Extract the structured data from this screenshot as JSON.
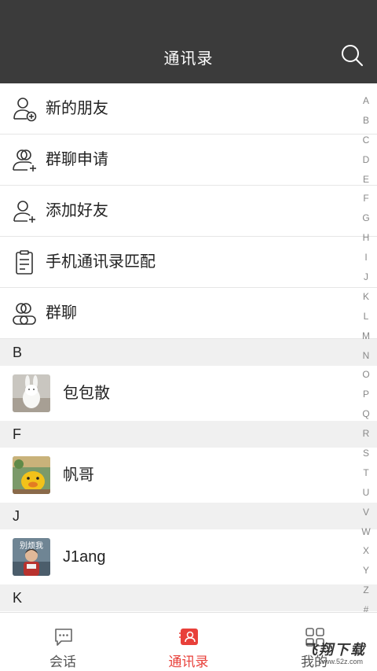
{
  "header": {
    "title": "通讯录"
  },
  "functions": [
    {
      "label": "新的朋友",
      "icon": "person-add-icon"
    },
    {
      "label": "群聊申请",
      "icon": "group-add-icon"
    },
    {
      "label": "添加好友",
      "icon": "add-friend-icon"
    },
    {
      "label": "手机通讯录匹配",
      "icon": "clipboard-icon"
    },
    {
      "label": "群聊",
      "icon": "group-icon"
    }
  ],
  "sections": [
    {
      "letter": "B",
      "contacts": [
        {
          "name": "包包散",
          "avatar": "bunny-avatar"
        }
      ]
    },
    {
      "letter": "F",
      "contacts": [
        {
          "name": "帆哥",
          "avatar": "duck-avatar"
        }
      ]
    },
    {
      "letter": "J",
      "contacts": [
        {
          "name": "J1ang",
          "avatar": "child-avatar",
          "avatar_text": "别烦我"
        }
      ]
    },
    {
      "letter": "K",
      "contacts": []
    }
  ],
  "index_letters": [
    "A",
    "B",
    "C",
    "D",
    "E",
    "F",
    "G",
    "H",
    "I",
    "J",
    "K",
    "L",
    "M",
    "N",
    "O",
    "P",
    "Q",
    "R",
    "S",
    "T",
    "U",
    "V",
    "W",
    "X",
    "Y",
    "Z",
    "#"
  ],
  "tabs": [
    {
      "label": "会话",
      "icon": "chat-bubble-icon",
      "active": false
    },
    {
      "label": "通讯录",
      "icon": "contacts-icon",
      "active": true
    },
    {
      "label": "我的",
      "icon": "grid-icon",
      "active": false
    }
  ],
  "watermark": {
    "text": "飞翔下载",
    "sub": "www.52z.com"
  },
  "colors": {
    "header_bg": "#3b3b3b",
    "accent": "#e8403a",
    "section_bg": "#f0f0f0"
  }
}
